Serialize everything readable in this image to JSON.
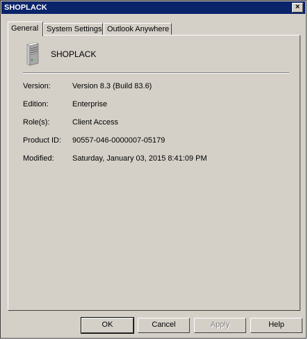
{
  "window": {
    "title": "SHOPLACK",
    "close_glyph": "×"
  },
  "tabs": [
    {
      "label": "General",
      "active": true
    },
    {
      "label": "System Settings",
      "active": false
    },
    {
      "label": "Outlook Anywhere",
      "active": false
    }
  ],
  "general": {
    "server_icon": "server-icon",
    "server_name": "SHOPLACK",
    "fields": [
      {
        "label": "Version:",
        "value": "Version 8.3 (Build 83.6)"
      },
      {
        "label": "Edition:",
        "value": "Enterprise"
      },
      {
        "label": "Role(s):",
        "value": "Client Access"
      },
      {
        "label": "Product ID:",
        "value": "90557-046-0000007-05179"
      },
      {
        "label": "Modified:",
        "value": "Saturday, January 03, 2015 8:41:09 PM"
      }
    ]
  },
  "buttons": {
    "ok": "OK",
    "cancel": "Cancel",
    "apply": "Apply",
    "help": "Help"
  },
  "colors": {
    "titlebar": "#0a246a",
    "face": "#d4d0c8"
  }
}
